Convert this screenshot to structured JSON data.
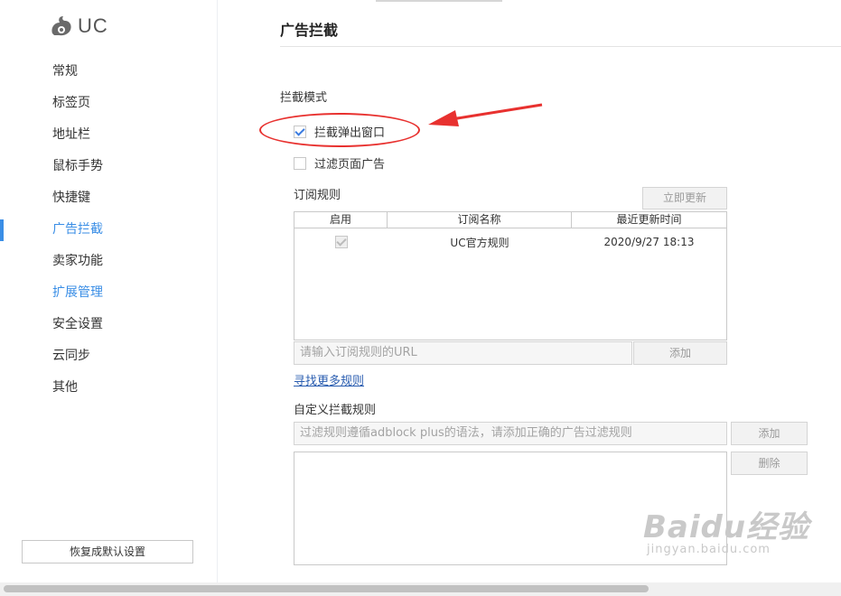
{
  "app": {
    "logo_text": "UC"
  },
  "sidebar": {
    "items": [
      {
        "label": "常规"
      },
      {
        "label": "标签页"
      },
      {
        "label": "地址栏"
      },
      {
        "label": "鼠标手势"
      },
      {
        "label": "快捷键"
      },
      {
        "label": "广告拦截"
      },
      {
        "label": "卖家功能"
      },
      {
        "label": "扩展管理"
      },
      {
        "label": "安全设置"
      },
      {
        "label": "云同步"
      },
      {
        "label": "其他"
      }
    ],
    "active_index": 5,
    "restore_label": "恢复成默认设置"
  },
  "main": {
    "title": "广告拦截",
    "block_mode_label": "拦截模式",
    "options": [
      {
        "label": "拦截弹出窗口",
        "checked": true
      },
      {
        "label": "过滤页面广告",
        "checked": false
      }
    ],
    "subscription": {
      "label": "订阅规则",
      "update_now": "立即更新",
      "columns": [
        "启用",
        "订阅名称",
        "最近更新时间"
      ],
      "rows": [
        {
          "enabled": true,
          "name": "UC官方规则",
          "updated": "2020/9/27 18:13"
        }
      ],
      "url_placeholder": "请输入订阅规则的URL",
      "add_label": "添加",
      "more_rules_link": "寻找更多规则"
    },
    "custom": {
      "label": "自定义拦截规则",
      "placeholder": "过滤规则遵循adblock plus的语法，请添加正确的广告过滤规则",
      "add_label": "添加",
      "delete_label": "删除"
    }
  },
  "watermark": {
    "brand": "Baidu经验",
    "url": "jingyan.baidu.com"
  },
  "colors": {
    "accent": "#3a8ee6",
    "annotation": "#e8312f"
  }
}
